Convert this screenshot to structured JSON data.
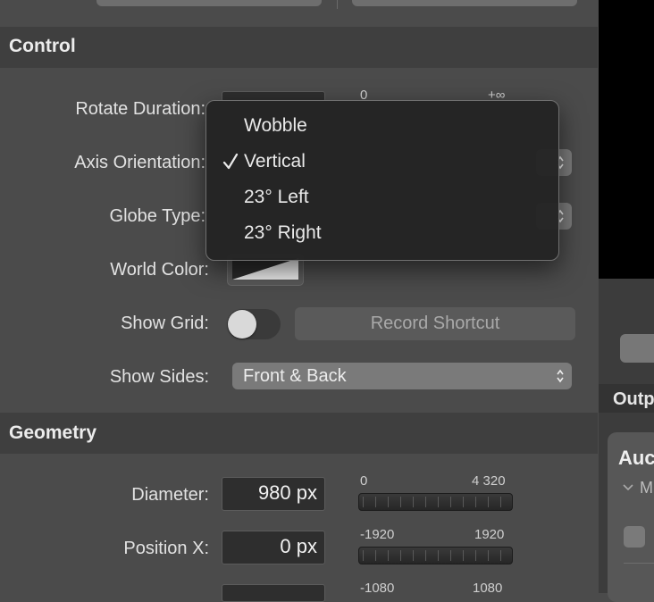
{
  "control": {
    "title": "Control",
    "rotate_duration": {
      "label": "Rotate Duration:",
      "range_min": "0",
      "range_max": "+∞"
    },
    "axis_orientation": {
      "label": "Axis Orientation:",
      "options": [
        "Wobble",
        "Vertical",
        "23° Left",
        "23° Right"
      ],
      "selected": "Vertical"
    },
    "globe_type": {
      "label": "Globe Type:"
    },
    "world_color": {
      "label": "World Color:"
    },
    "show_grid": {
      "label": "Show Grid:",
      "toggle_on": false,
      "shortcut_label": "Record Shortcut"
    },
    "show_sides": {
      "label": "Show Sides:",
      "value": "Front & Back"
    }
  },
  "geometry": {
    "title": "Geometry",
    "diameter": {
      "label": "Diameter:",
      "value": "980 px",
      "range_min": "0",
      "range_max": "4 320"
    },
    "position_x": {
      "label": "Position X:",
      "value": "0 px",
      "range_min": "-1920",
      "range_max": "1920"
    },
    "position_y": {
      "range_min": "-1080",
      "range_max": "1080"
    }
  },
  "right_panel": {
    "header_fragment": "Outp",
    "card_title_fragment": "Auc",
    "card_sub_fragment": "M"
  },
  "icons": [
    "checkmark-icon",
    "stepper-arrows-icon",
    "chevron-down-icon"
  ]
}
